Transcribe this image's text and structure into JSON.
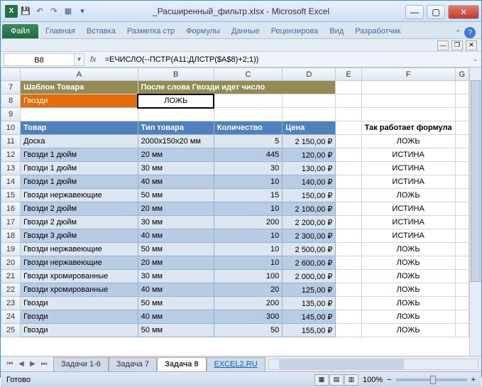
{
  "title": "_Расширенный_фильтр.xlsx - Microsoft Excel",
  "ribbon": {
    "file": "Файл",
    "tabs": [
      "Главная",
      "Вставка",
      "Разметка стр",
      "Формулы",
      "Данные",
      "Рецензирова",
      "Вид",
      "Разработчик"
    ]
  },
  "name_box": "B8",
  "fx_label": "fx",
  "formula": "=ЕЧИСЛО(--ПСТР(A11;ДЛСТР($A$8)+2;1))",
  "columns": [
    "A",
    "B",
    "C",
    "D",
    "E",
    "F",
    "G"
  ],
  "row7": {
    "A": "Шаблон Товара",
    "B": "После слова Гвозди идет число"
  },
  "row8": {
    "A": "Гвозди",
    "B": "ЛОЖЬ"
  },
  "row10": {
    "A": "Товар",
    "B": "Тип товара",
    "C": "Количество",
    "D": "Цена",
    "F": "Так работает формула"
  },
  "rows": [
    {
      "n": 11,
      "A": "Доска",
      "B": "2000х150х20 мм",
      "C": "5",
      "D": "2 150,00 ₽",
      "F": "ЛОЖЬ"
    },
    {
      "n": 12,
      "A": "Гвозди 1 дюйм",
      "B": "20 мм",
      "C": "445",
      "D": "120,00 ₽",
      "F": "ИСТИНА"
    },
    {
      "n": 13,
      "A": "Гвозди 1 дюйм",
      "B": "30 мм",
      "C": "30",
      "D": "130,00 ₽",
      "F": "ИСТИНА"
    },
    {
      "n": 14,
      "A": "Гвозди 1 дюйм",
      "B": "40 мм",
      "C": "10",
      "D": "140,00 ₽",
      "F": "ИСТИНА"
    },
    {
      "n": 15,
      "A": "Гвозди нержавеющие",
      "B": "50 мм",
      "C": "15",
      "D": "150,00 ₽",
      "F": "ЛОЖЬ"
    },
    {
      "n": 16,
      "A": "Гвозди 2 дюйм",
      "B": "20 мм",
      "C": "10",
      "D": "2 100,00 ₽",
      "F": "ИСТИНА"
    },
    {
      "n": 17,
      "A": "Гвозди 2 дюйм",
      "B": "30 мм",
      "C": "200",
      "D": "2 200,00 ₽",
      "F": "ИСТИНА"
    },
    {
      "n": 18,
      "A": "Гвозди 3 дюйм",
      "B": "40 мм",
      "C": "10",
      "D": "2 300,00 ₽",
      "F": "ИСТИНА"
    },
    {
      "n": 19,
      "A": "Гвозди нержавеющие",
      "B": "50 мм",
      "C": "10",
      "D": "2 500,00 ₽",
      "F": "ЛОЖЬ"
    },
    {
      "n": 20,
      "A": "Гвозди нержавеющие",
      "B": "20 мм",
      "C": "10",
      "D": "2 600,00 ₽",
      "F": "ЛОЖЬ"
    },
    {
      "n": 21,
      "A": "Гвозди хромированные",
      "B": "30 мм",
      "C": "100",
      "D": "2 000,00 ₽",
      "F": "ЛОЖЬ"
    },
    {
      "n": 22,
      "A": "Гвозди хромированные",
      "B": "40 мм",
      "C": "20",
      "D": "125,00 ₽",
      "F": "ЛОЖЬ"
    },
    {
      "n": 23,
      "A": "Гвозди",
      "B": "50 мм",
      "C": "200",
      "D": "135,00 ₽",
      "F": "ЛОЖЬ"
    },
    {
      "n": 24,
      "A": "Гвозди",
      "B": "40 мм",
      "C": "300",
      "D": "145,00 ₽",
      "F": "ЛОЖЬ"
    },
    {
      "n": 25,
      "A": "Гвозди",
      "B": "50 мм",
      "C": "50",
      "D": "155,00 ₽",
      "F": "ЛОЖЬ"
    }
  ],
  "sheets": [
    "Задачи 1-6",
    "Задача 7",
    "Задача 8",
    "EXCEL2.RU"
  ],
  "active_sheet": 2,
  "status": "Готово",
  "zoom": "100%"
}
